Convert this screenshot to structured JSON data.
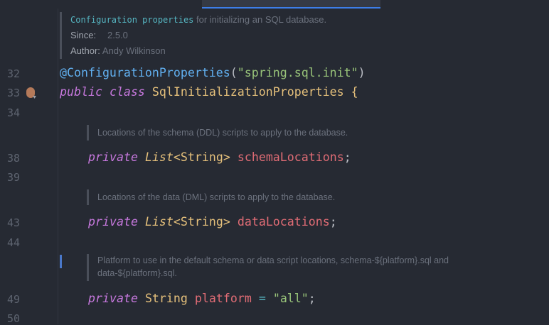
{
  "class_doc": {
    "link": "Configuration properties",
    "text": " for initializing an SQL database.",
    "since_label": "Since:",
    "since_value": "2.5.0",
    "author_label": "Author:",
    "author_value": "Andy Wilkinson"
  },
  "lines": {
    "l32": {
      "num": "32",
      "annotation": "@ConfigurationProperties",
      "p1": "(",
      "str": "\"spring.sql.init\"",
      "p2": ")"
    },
    "l33": {
      "num": "33",
      "kw1": "public",
      "kw2": "class",
      "name": "SqlInitializationProperties",
      "brace": "{"
    },
    "l34": {
      "num": "34"
    },
    "doc_schema": "Locations of the schema (DDL) scripts to apply to the database.",
    "l38": {
      "num": "38",
      "kw": "private",
      "type1": "List",
      "lt": "<",
      "type2": "String",
      "gt": ">",
      "field": "schemaLocations",
      "semi": ";"
    },
    "l39": {
      "num": "39"
    },
    "doc_data": "Locations of the data (DML) scripts to apply to the database.",
    "l43": {
      "num": "43",
      "kw": "private",
      "type1": "List",
      "lt": "<",
      "type2": "String",
      "gt": ">",
      "field": "dataLocations",
      "semi": ";"
    },
    "l44": {
      "num": "44"
    },
    "doc_platform_1": "Platform to use in the default schema or data script locations, schema-${platform}.sql and",
    "doc_platform_2": "data-${platform}.sql.",
    "l49": {
      "num": "49",
      "kw": "private",
      "type": "String",
      "field": "platform",
      "eq": "=",
      "str": "\"all\"",
      "semi": ";"
    },
    "l50": {
      "num": "50"
    }
  }
}
